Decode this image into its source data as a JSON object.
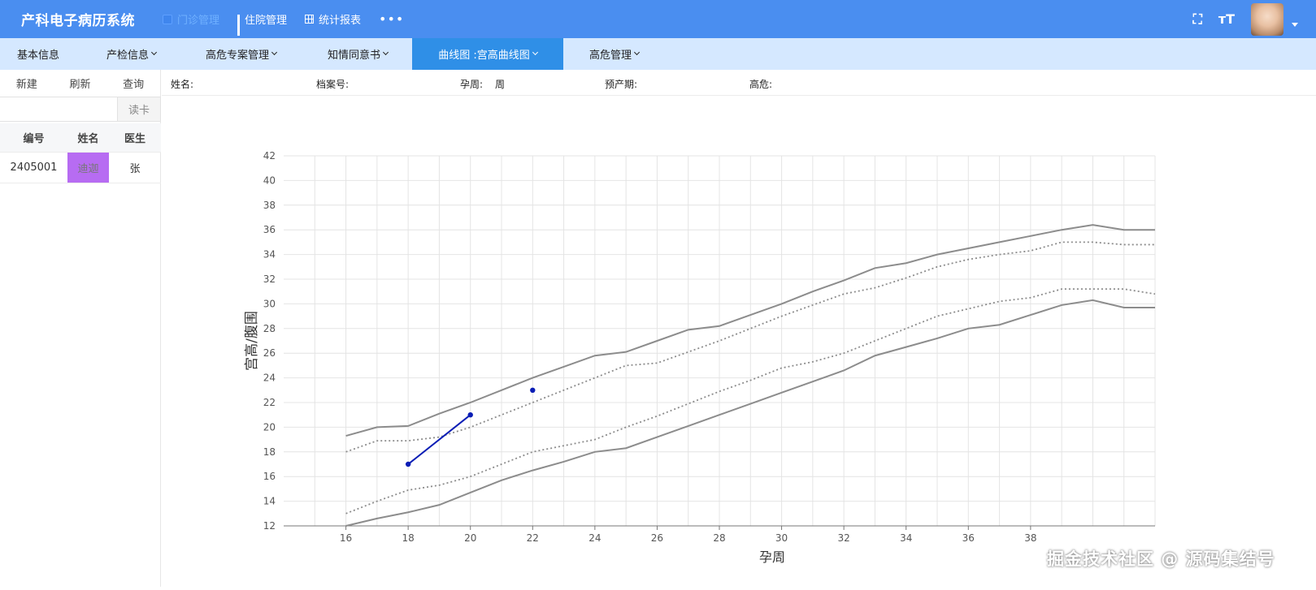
{
  "header": {
    "app_title": "产科电子病历系统",
    "nav": [
      {
        "label": "门诊管理",
        "icon": "square-icon"
      },
      {
        "label": "住院管理",
        "icon": "bar-chart-icon"
      },
      {
        "label": "统计报表",
        "icon": "table-icon"
      }
    ],
    "more_label": "•••",
    "fullscreen_icon": "⛶",
    "font_size_icon": "тT"
  },
  "subnav": {
    "items": [
      {
        "label": "基本信息"
      },
      {
        "label": "产检信息"
      },
      {
        "label": "高危专案管理"
      },
      {
        "label": "知情同意书"
      },
      {
        "label": "曲线图 :宫高曲线图"
      },
      {
        "label": "高危管理"
      }
    ]
  },
  "left": {
    "actions": [
      "新建",
      "刷新",
      "查询"
    ],
    "search_value": "",
    "search_placeholder": "",
    "read_card": "读卡",
    "table": {
      "headers": [
        "编号",
        "姓名",
        "医生"
      ],
      "rows": [
        [
          "2405001",
          "迪迦",
          "张"
        ]
      ]
    }
  },
  "info": {
    "name_label": "姓名:",
    "file_label": "档案号:",
    "week_label": "孕周:",
    "week_unit": "周",
    "due_label": "预产期:",
    "risk_label": "高危:"
  },
  "chart_data": {
    "type": "line",
    "xlabel": "孕周",
    "ylabel": "宫高/腹围",
    "xlim": [
      14,
      41
    ],
    "ylim": [
      12,
      42
    ],
    "xticks": [
      16,
      18,
      20,
      22,
      24,
      26,
      28,
      30,
      32,
      34,
      36,
      38
    ],
    "yticks": [
      12,
      14,
      16,
      18,
      20,
      22,
      24,
      26,
      28,
      30,
      32,
      34,
      36,
      38,
      40,
      42
    ],
    "grid": true,
    "x": [
      16,
      17,
      18,
      19,
      20,
      21,
      22,
      23,
      24,
      25,
      26,
      27,
      28,
      29,
      30,
      31,
      32,
      33,
      34,
      35,
      36,
      37,
      38,
      39,
      40,
      41
    ],
    "series": [
      {
        "style": "solid",
        "color": "#8c8c8c",
        "values": [
          19.3,
          20.0,
          20.1,
          21.1,
          22.0,
          23.0,
          24.0,
          24.9,
          25.8,
          26.1,
          27.0,
          27.9,
          28.2,
          29.1,
          30.0,
          31.0,
          31.9,
          32.9,
          33.3,
          34.0,
          34.5,
          35.0,
          35.5,
          36.0,
          36.4,
          36.0
        ]
      },
      {
        "style": "dotted",
        "color": "#8c8c8c",
        "values": [
          18.0,
          18.9,
          18.9,
          19.2,
          20.0,
          21.0,
          22.0,
          23.0,
          24.0,
          25.0,
          25.2,
          26.1,
          27.0,
          28.0,
          29.0,
          29.9,
          30.8,
          31.3,
          32.1,
          33.0,
          33.6,
          34.0,
          34.3,
          35.0,
          35.0,
          34.8
        ]
      },
      {
        "style": "dotted",
        "color": "#8c8c8c",
        "values": [
          13.0,
          14.0,
          14.9,
          15.3,
          16.0,
          17.0,
          18.0,
          18.5,
          19.0,
          20.0,
          20.9,
          21.9,
          22.9,
          23.8,
          24.8,
          25.3,
          26.0,
          27.0,
          28.0,
          29.0,
          29.6,
          30.2,
          30.5,
          31.2,
          31.2,
          31.2
        ]
      },
      {
        "style": "solid",
        "color": "#8c8c8c",
        "values": [
          12.0,
          12.6,
          13.1,
          13.7,
          14.7,
          15.7,
          16.5,
          17.2,
          18.0,
          18.3,
          19.2,
          20.1,
          21.0,
          21.9,
          22.8,
          23.7,
          24.6,
          25.8,
          26.5,
          27.2,
          28.0,
          28.3,
          29.1,
          29.9,
          30.3,
          29.7
        ]
      }
    ],
    "measurements": {
      "color": "#0a1db5",
      "connected": [
        [
          18,
          17
        ],
        [
          20,
          21
        ]
      ],
      "single": [
        [
          22,
          23
        ]
      ]
    },
    "extend_x_to": 42,
    "tail_values": [
      36.0,
      34.8,
      30.8,
      29.7
    ]
  },
  "watermark": "掘金技术社区 @ 源码集结号"
}
